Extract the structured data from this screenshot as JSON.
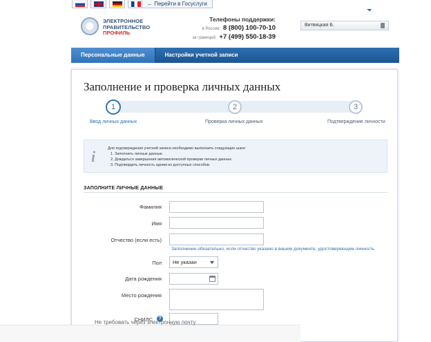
{
  "top_bar": {
    "flags": [
      {
        "name": "flag-ru"
      },
      {
        "name": "flag-en"
      },
      {
        "name": "flag-de"
      },
      {
        "name": "flag-fr"
      }
    ],
    "gosuslugi_label": "← Перейти в Госуслуги"
  },
  "header": {
    "logo_line1": "ЭЛЕКТРОННОЕ",
    "logo_line2": "ПРАВИТЕЛЬСТВО",
    "logo_line3": "ПРОФИЛЬ",
    "support_title": "Телефоны поддержки:",
    "phone_ru_label": "в России:",
    "phone_ru": "8 (800) 100-70-10",
    "phone_abroad_label": "за границей:",
    "phone_abroad": "+7 (499) 550-18-39",
    "user_name": "Витвицкая Б."
  },
  "nav": {
    "tabs": [
      {
        "label": "Персональные данные"
      },
      {
        "label": "Настройки учетной записи"
      }
    ]
  },
  "page": {
    "title": "Заполнение и проверка личных данных",
    "steps": [
      {
        "number": "1",
        "label": "Ввод личных данных"
      },
      {
        "number": "2",
        "label": "Проверка личных данных"
      },
      {
        "number": "3",
        "label": "Подтверждение личности"
      }
    ],
    "info": {
      "icon": "i",
      "intro": "Для подтверждения учетной записи необходимо выполнить следующие шаги:",
      "items": [
        "1. Заполнить личные данные.",
        "2. Дождаться завершения автоматической проверки личных данных.",
        "3. Подтвердить личность одним из доступных способов."
      ]
    },
    "section_title": "ЗАПОЛНИТЕ ЛИЧНЫЕ ДАННЫЕ",
    "form": {
      "surname_label": "Фамилия",
      "name_label": "Имя",
      "patronymic_label": "Отчество (если есть)",
      "patronymic_hint": "Заполнение обязательно, если отчество указано в вашем документе, удостоверяющем личность",
      "gender_label": "Пол",
      "gender_value": "Не указан",
      "birthdate_label": "Дата рождения",
      "birthplace_label": "Место рождения",
      "snils_label": "СНИЛС"
    },
    "bottom_text": "Не требовать через электронную почту"
  }
}
